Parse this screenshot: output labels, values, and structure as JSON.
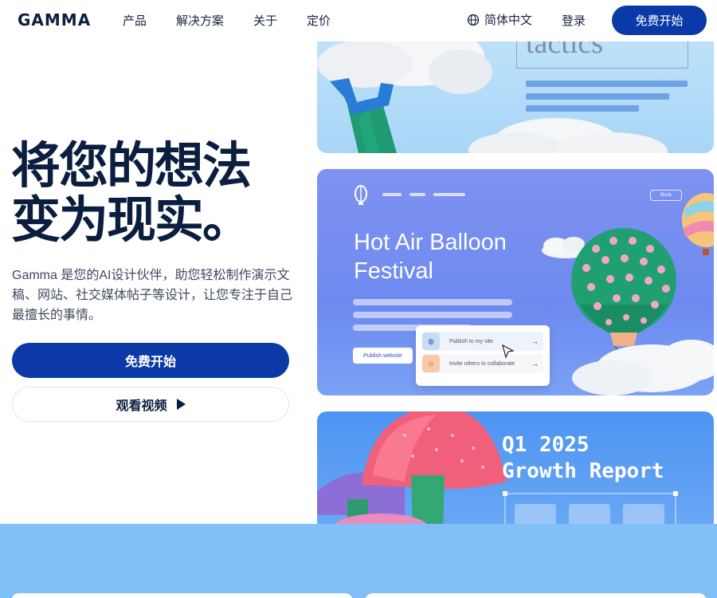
{
  "header": {
    "logo": "GAMMA",
    "nav": [
      "产品",
      "解决方案",
      "关于",
      "定价"
    ],
    "language": "简体中文",
    "login": "登录",
    "cta": "免费开始"
  },
  "hero": {
    "title_line1": "将您的想法",
    "title_line2": "变为现实。",
    "description": "Gamma 是您的AI设计伙伴，助您轻松制作演示文稿、网站、社交媒体帖子等设计，让您专注于自己最擅长的事情。",
    "primary_button": "免费开始",
    "secondary_button": "观看视频"
  },
  "cards": {
    "card1": {
      "title": "tactics"
    },
    "card2": {
      "title_line1": "Hot Air Balloon",
      "title_line2": "Festival",
      "book": "Book",
      "publish": "Publish website",
      "popup_items": [
        {
          "label": "Publish to my site",
          "icon": "globe-icon"
        },
        {
          "label": "Invite others to collaborate",
          "icon": "people-icon"
        }
      ]
    },
    "card3": {
      "title_line1": "Q1 2025",
      "title_line2": "Growth Report"
    }
  },
  "colors": {
    "brand_blue": "#0b3aa8",
    "heading": "#0b1e3f",
    "band": "#80bff7"
  }
}
